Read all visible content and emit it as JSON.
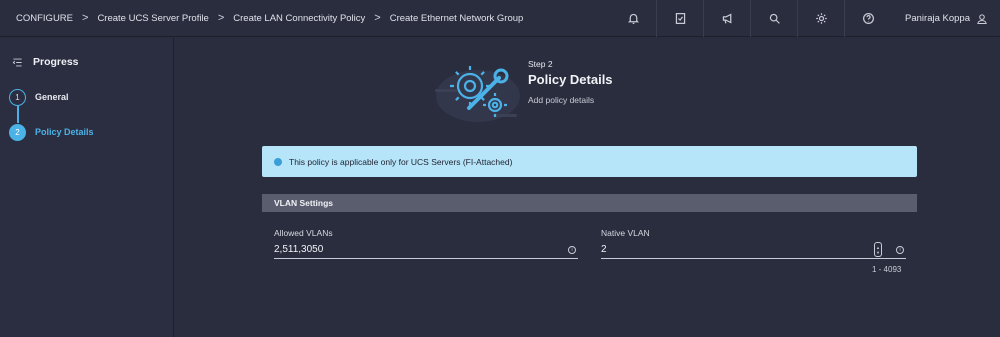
{
  "breadcrumb": {
    "items": [
      "CONFIGURE",
      "Create UCS Server Profile",
      "Create LAN Connectivity Policy",
      "Create Ethernet Network Group"
    ],
    "separator": ">"
  },
  "topbar": {
    "icons": [
      "bell-icon",
      "checklist-icon",
      "megaphone-icon",
      "search-icon",
      "gear-icon",
      "help-icon"
    ],
    "user_name": "Paniraja Koppa"
  },
  "sidebar": {
    "title": "Progress",
    "steps": [
      {
        "number": "1",
        "label": "General"
      },
      {
        "number": "2",
        "label": "Policy Details"
      }
    ],
    "active_step": 2
  },
  "header": {
    "step_label": "Step 2",
    "title": "Policy Details",
    "subtitle": "Add policy details"
  },
  "info_banner": {
    "text": "This policy is applicable only for UCS Servers (FI-Attached)"
  },
  "vlan_settings": {
    "section_title": "VLAN Settings",
    "allowed_vlans": {
      "label": "Allowed VLANs",
      "value": "2,511,3050"
    },
    "native_vlan": {
      "label": "Native VLAN",
      "value": "2",
      "range": "1 - 4093"
    }
  },
  "colors": {
    "accent": "#4bb2e8",
    "background": "#2a2d3e",
    "info_banner": "#b6e4f8",
    "section_header": "#5a5d6e"
  }
}
